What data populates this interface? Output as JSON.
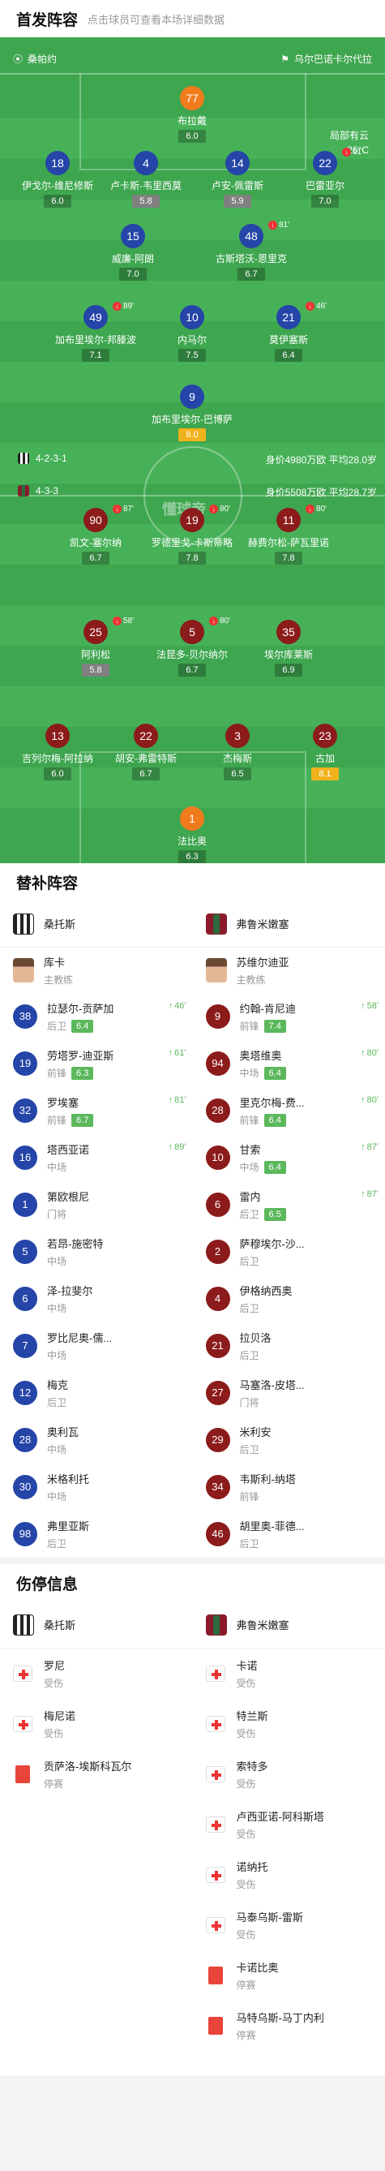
{
  "lineup": {
    "title": "首发阵容",
    "hint": "点击球员可查看本场详细数据"
  },
  "home": {
    "name": "桑帕约",
    "formation": "4-2-3-1",
    "avg": "身价4980万欧 平均28.0岁"
  },
  "away": {
    "name": "乌尔巴诺卡尔代拉",
    "formation": "4-3-3",
    "avg": "身价5508万欧 平均28.7岁"
  },
  "weather": {
    "desc": "局部有云",
    "temp": "26°C"
  },
  "watermark": "懂球帝",
  "home_players": [
    {
      "num": "77",
      "name": "布拉戴",
      "rate": "6.0"
    },
    {
      "num": "18",
      "name": "伊戈尔-维尼修斯",
      "rate": "6.0"
    },
    {
      "num": "4",
      "name": "卢卡斯-韦里西莫",
      "rate": "5.8"
    },
    {
      "num": "14",
      "name": "卢安-佩雷斯",
      "rate": "5.9"
    },
    {
      "num": "22",
      "name": "巴雷亚尔",
      "rate": "7.0",
      "ev": "61'"
    },
    {
      "num": "15",
      "name": "威廉-阿朗",
      "rate": "7.0"
    },
    {
      "num": "48",
      "name": "古斯塔沃-恩里克",
      "rate": "6.7",
      "ev": "81'"
    },
    {
      "num": "49",
      "name": "加布里埃尔-邦滕波",
      "rate": "7.1",
      "ev": "89'"
    },
    {
      "num": "10",
      "name": "内马尔",
      "rate": "7.5"
    },
    {
      "num": "21",
      "name": "莫伊塞斯",
      "rate": "6.4",
      "ev": "46'"
    },
    {
      "num": "9",
      "name": "加布里埃尔-巴博萨",
      "rate": "8.0"
    }
  ],
  "away_players": [
    {
      "num": "90",
      "name": "凯文-塞尔纳",
      "rate": "6.7",
      "ev": "87'"
    },
    {
      "num": "19",
      "name": "罗德里戈-卡斯蒂略",
      "rate": "7.8",
      "ev": "80'"
    },
    {
      "num": "11",
      "name": "赫费尔松-萨瓦里诺",
      "rate": "7.8",
      "ev": "80'"
    },
    {
      "num": "25",
      "name": "阿利松",
      "rate": "5.8",
      "ev": "58'"
    },
    {
      "num": "5",
      "name": "法昆多-贝尔纳尔",
      "rate": "6.7",
      "ev": "80'"
    },
    {
      "num": "35",
      "name": "埃尔库莱斯",
      "rate": "6.9"
    },
    {
      "num": "13",
      "name": "吉列尔梅-阿拉纳",
      "rate": "6.0"
    },
    {
      "num": "22",
      "name": "胡安-弗雷特斯",
      "rate": "6.7"
    },
    {
      "num": "3",
      "name": "杰梅斯",
      "rate": "6.5"
    },
    {
      "num": "23",
      "name": "古加",
      "rate": "8.1"
    },
    {
      "num": "1",
      "name": "法比奥",
      "rate": "6.3"
    }
  ],
  "bench": {
    "title": "替补阵容",
    "home_team": "桑托斯",
    "away_team": "弗鲁米嫩塞",
    "home_coach": {
      "name": "库卡",
      "role": "主教练"
    },
    "away_coach": {
      "name": "苏维尔迪亚",
      "role": "主教练"
    },
    "rows": [
      [
        {
          "num": "38",
          "name": "拉瑟尔-贡萨加",
          "pos": "后卫",
          "rate": "6.4",
          "ev": "46'"
        },
        {
          "num": "9",
          "name": "约翰-肯尼迪",
          "pos": "前锋",
          "rate": "7.4",
          "ev": "58'"
        }
      ],
      [
        {
          "num": "19",
          "name": "劳塔罗-迪亚斯",
          "pos": "前锋",
          "rate": "6.3",
          "ev": "61'"
        },
        {
          "num": "94",
          "name": "奥塔维奥",
          "pos": "中场",
          "rate": "6.4",
          "ev": "80'"
        }
      ],
      [
        {
          "num": "32",
          "name": "罗埃塞",
          "pos": "前锋",
          "rate": "6.7",
          "ev": "81'"
        },
        {
          "num": "28",
          "name": "里克尔梅-费...",
          "pos": "前锋",
          "rate": "6.4",
          "ev": "80'"
        }
      ],
      [
        {
          "num": "16",
          "name": "塔西亚诺",
          "pos": "中场",
          "ev": "89'"
        },
        {
          "num": "10",
          "name": "甘索",
          "pos": "中场",
          "rate": "6.4",
          "ev": "87'"
        }
      ],
      [
        {
          "num": "1",
          "name": "第欧根尼",
          "pos": "门将"
        },
        {
          "num": "6",
          "name": "雷内",
          "pos": "后卫",
          "rate": "6.5",
          "ev": "87'"
        }
      ],
      [
        {
          "num": "5",
          "name": "若昂-施密特",
          "pos": "中场"
        },
        {
          "num": "2",
          "name": "萨穆埃尔-沙...",
          "pos": "后卫"
        }
      ],
      [
        {
          "num": "6",
          "name": "泽-拉斐尔",
          "pos": "中场"
        },
        {
          "num": "4",
          "name": "伊格纳西奥",
          "pos": "后卫"
        }
      ],
      [
        {
          "num": "7",
          "name": "罗比尼奥-儒...",
          "pos": "中场"
        },
        {
          "num": "21",
          "name": "拉贝洛",
          "pos": "后卫"
        }
      ],
      [
        {
          "num": "12",
          "name": "梅克",
          "pos": "后卫"
        },
        {
          "num": "27",
          "name": "马塞洛-皮塔...",
          "pos": "门将"
        }
      ],
      [
        {
          "num": "28",
          "name": "奥利瓦",
          "pos": "中场"
        },
        {
          "num": "29",
          "name": "米利安",
          "pos": "后卫"
        }
      ],
      [
        {
          "num": "30",
          "name": "米格利托",
          "pos": "中场"
        },
        {
          "num": "34",
          "name": "韦斯利-纳塔",
          "pos": "前锋"
        }
      ],
      [
        {
          "num": "98",
          "name": "弗里亚斯",
          "pos": "后卫"
        },
        {
          "num": "46",
          "name": "胡里奥-菲德...",
          "pos": "后卫"
        }
      ]
    ]
  },
  "injury": {
    "title": "伤停信息",
    "home_team": "桑托斯",
    "away_team": "弗鲁米嫩塞",
    "home": [
      {
        "name": "罗尼",
        "status": "受伤",
        "type": "injury"
      },
      {
        "name": "梅尼诺",
        "status": "受伤",
        "type": "injury"
      },
      {
        "name": "贡萨洛-埃斯科瓦尔",
        "status": "停赛",
        "type": "suspension"
      }
    ],
    "away": [
      {
        "name": "卡诺",
        "status": "受伤",
        "type": "injury"
      },
      {
        "name": "特兰斯",
        "status": "受伤",
        "type": "injury"
      },
      {
        "name": "索特多",
        "status": "受伤",
        "type": "injury"
      },
      {
        "name": "卢西亚诺-阿科斯塔",
        "status": "受伤",
        "type": "injury"
      },
      {
        "name": "诺纳托",
        "status": "受伤",
        "type": "injury"
      },
      {
        "name": "马泰乌斯-雷斯",
        "status": "受伤",
        "type": "injury"
      },
      {
        "name": "卡诺比奥",
        "status": "停赛",
        "type": "suspension"
      },
      {
        "name": "马特乌斯-马丁内利",
        "status": "停赛",
        "type": "suspension"
      }
    ]
  }
}
